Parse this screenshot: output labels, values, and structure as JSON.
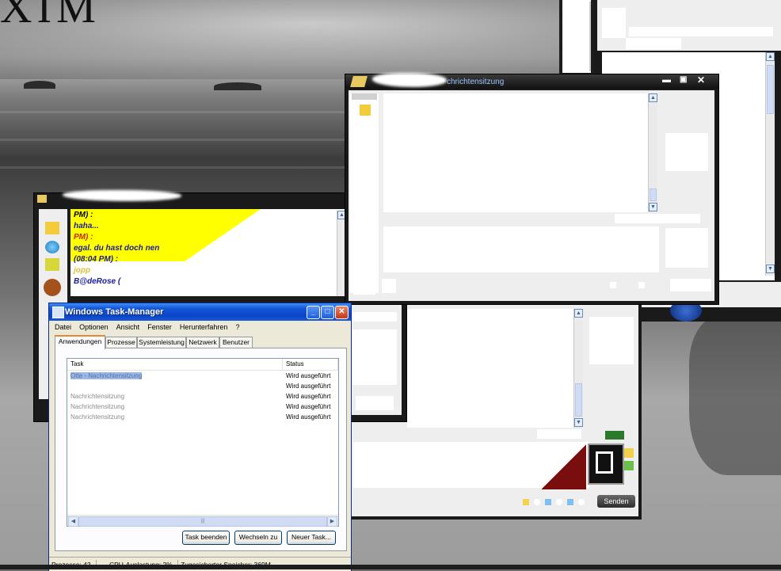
{
  "wallpaper": {
    "title_fragment": "XIM"
  },
  "messenger_main": {
    "title": "chrichtensitzung"
  },
  "messenger_left": {
    "chat_lines": [
      {
        "text": "PM) :",
        "color": "#cc2200"
      },
      {
        "text": "haha...",
        "color": "#1a1a9c"
      },
      {
        "text": "PM) :",
        "color": "#cc2200"
      },
      {
        "text": "egal. du hast doch nen",
        "color": "#1a1a9c"
      },
      {
        "text": "(08:04 PM) :",
        "color": "#1a1a9c"
      },
      {
        "text": "jopp",
        "color": "#d8c040"
      },
      {
        "text": "B@deRose (",
        "color": "#1a1a9c"
      }
    ]
  },
  "messenger_back": {
    "send_button": "Senden",
    "dropdown_placeholder": ""
  },
  "taskmanager": {
    "title": "Windows Task-Manager",
    "menu": [
      "Datei",
      "Optionen",
      "Ansicht",
      "Fenster",
      "Herunterfahren",
      "?"
    ],
    "tabs": [
      "Anwendungen",
      "Prozesse",
      "Systemleistung",
      "Netzwerk",
      "Benutzer"
    ],
    "columns": {
      "task": "Task",
      "status": "Status"
    },
    "rows": [
      {
        "task": "Otte - Nachrichtensitzung",
        "status": "Wird ausgeführt",
        "selected": true
      },
      {
        "task": "",
        "status": "Wird ausgeführt",
        "selected": false
      },
      {
        "task": "Nachrichtensitzung",
        "status": "Wird ausgeführt",
        "selected": false
      },
      {
        "task": "Nachrichtensitzung",
        "status": "Wird ausgeführt",
        "selected": false
      },
      {
        "task": "Nachrichtensitzung",
        "status": "Wird ausgeführt",
        "selected": false
      }
    ],
    "scroll_grip": "|||",
    "buttons": {
      "end_task": "Task beenden",
      "switch_to": "Wechseln zu",
      "new_task": "Neuer Task..."
    },
    "status": {
      "processes": "Prozesse: 42",
      "cpu": "CPU-Auslastung: 2%",
      "memory": "Zugesicherter Speicher: 369M"
    }
  }
}
